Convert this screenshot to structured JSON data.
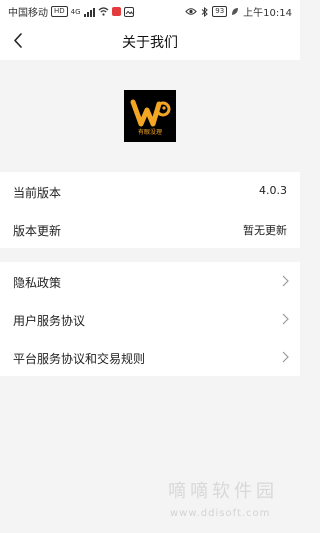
{
  "status_bar": {
    "carrier": "中国移动",
    "hd_badge": "HD",
    "network": "4G",
    "battery": "93",
    "time": "上午10:14"
  },
  "nav": {
    "title": "关于我们",
    "back_icon": "chevron-left-icon"
  },
  "logo": {
    "brand_text": "有眼没理"
  },
  "version_group": [
    {
      "label": "当前版本",
      "value": "4.0.3"
    },
    {
      "label": "版本更新",
      "value": "暂无更新"
    }
  ],
  "policy_group": [
    {
      "label": "隐私政策"
    },
    {
      "label": "用户服务协议"
    },
    {
      "label": "平台服务协议和交易规则"
    }
  ],
  "watermark": {
    "name": "嘀嘀软件园",
    "url": "www.ddisoft.com"
  },
  "colors": {
    "background": "#f4f4f4",
    "logo_accent": "#f2a623"
  }
}
